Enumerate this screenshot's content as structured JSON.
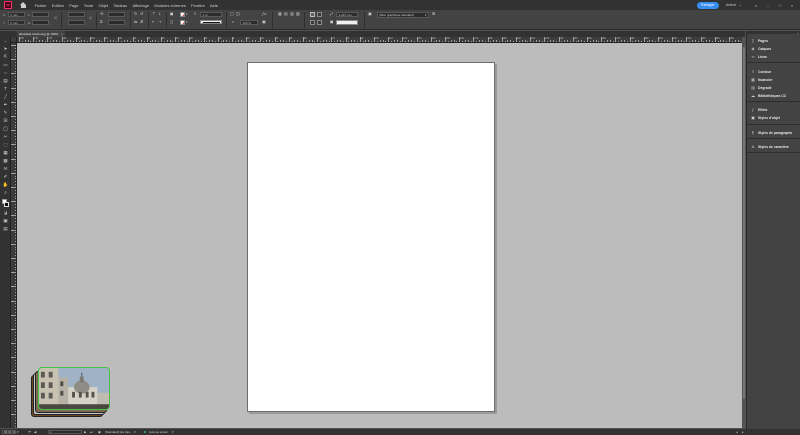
{
  "app": {
    "icon_label": "Id",
    "menu": [
      "Fichier",
      "Edition",
      "Page",
      "Texte",
      "Objet",
      "Tableau",
      "Affichage",
      "Modules externes",
      "Fenêtre",
      "Aide"
    ],
    "share_label": "Partager",
    "workspace_label": "Acteur",
    "accent_color": "#ff3366",
    "share_color": "#378ef0"
  },
  "control_bar": {
    "x_value": "0 mm",
    "y_value": "0 mm",
    "stroke_weight": "1 pt",
    "zoom_percent": "100 %",
    "offset_value": "4,233 mm",
    "object_style": "[Bloc graphique standard]"
  },
  "document_tab": {
    "label": "abstrakte zeichnung @ 100%",
    "close": "×"
  },
  "ruler": {
    "labels": [
      "150",
      "140",
      "130",
      "120",
      "110",
      "100",
      "90",
      "80",
      "70",
      "60",
      "50",
      "40",
      "30",
      "20",
      "10",
      "0",
      "10",
      "20",
      "30",
      "40",
      "50",
      "60",
      "70",
      "80",
      "90",
      "100",
      "110",
      "120",
      "130",
      "140",
      "150",
      "160",
      "170",
      "180",
      "190",
      "200",
      "210",
      "220",
      "230",
      "240",
      "250",
      "260",
      "270",
      "280",
      "290",
      "300",
      "310",
      "320",
      "330",
      "340",
      "350",
      "360"
    ]
  },
  "status_bar": {
    "zoom": "96,61 %",
    "page": "1",
    "style": "[Standard] (de trav...",
    "preflight": "Aucune erreur",
    "preflight_color": "#3cb371"
  },
  "panels": [
    {
      "group": 1,
      "items": [
        {
          "label": "Pages",
          "icon": "pages-icon"
        },
        {
          "label": "Calques",
          "icon": "layers-icon"
        },
        {
          "label": "Liens",
          "icon": "links-icon"
        }
      ]
    },
    {
      "group": 2,
      "items": [
        {
          "label": "Contour",
          "icon": "stroke-icon"
        },
        {
          "label": "Nuancier",
          "icon": "swatches-icon"
        },
        {
          "label": "Dégradé",
          "icon": "gradient-icon"
        },
        {
          "label": "Bibliothèques CC",
          "icon": "cc-libraries-icon"
        }
      ]
    },
    {
      "group": 3,
      "items": [
        {
          "label": "Effets",
          "icon": "effects-icon"
        },
        {
          "label": "Styles d'objet",
          "icon": "object-styles-icon"
        }
      ]
    },
    {
      "group": 4,
      "items": [
        {
          "label": "Styles de paragraphe",
          "icon": "paragraph-styles-icon"
        }
      ]
    },
    {
      "group": 5,
      "items": [
        {
          "label": "Styles de caractère",
          "icon": "character-styles-icon"
        }
      ]
    }
  ]
}
